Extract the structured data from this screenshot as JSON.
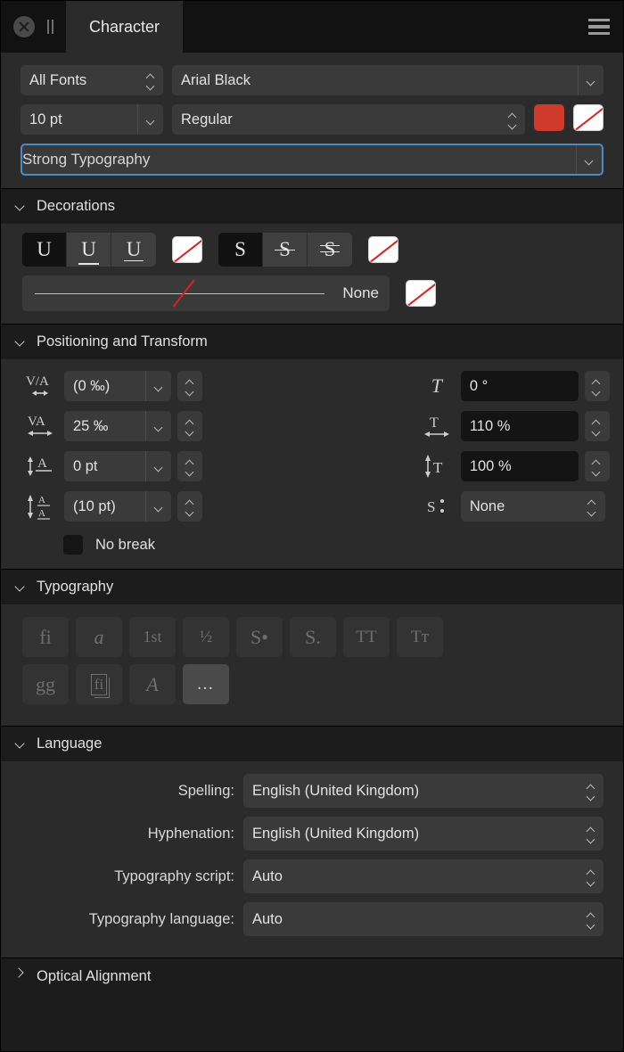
{
  "window": {
    "tab_label": "Character",
    "close_icon": "close-circle-icon",
    "grip_icon": "pause-grip-icon",
    "menu_icon": "hamburger-menu-icon"
  },
  "font_controls": {
    "font_class": "All Fonts",
    "font_family": "Arial Black",
    "font_size": "10 pt",
    "font_style": "Regular",
    "fill_color": "#cf3a2a",
    "stroke_color": "none",
    "text_style": "Strong Typography"
  },
  "sections": {
    "decorations": {
      "title": "Decorations",
      "expanded": true
    },
    "positioning": {
      "title": "Positioning and Transform",
      "expanded": true
    },
    "typography": {
      "title": "Typography",
      "expanded": true
    },
    "language": {
      "title": "Language",
      "expanded": true
    },
    "optical_alignment": {
      "title": "Optical Alignment",
      "expanded": false
    }
  },
  "decorations": {
    "underline_buttons": [
      {
        "label": "U",
        "name": "underline-none-button",
        "active": true
      },
      {
        "label": "U",
        "name": "underline-single-button",
        "active": false
      },
      {
        "label": "U",
        "name": "underline-double-button",
        "active": false
      }
    ],
    "underline_color": "none",
    "strikethrough_buttons": [
      {
        "label": "S",
        "name": "strikethrough-none-button",
        "active": true
      },
      {
        "label": "S",
        "name": "strikethrough-single-button",
        "active": false
      },
      {
        "label": "S",
        "name": "strikethrough-double-button",
        "active": false
      }
    ],
    "strikethrough_color": "none",
    "line_style_label": "None",
    "line_style_color": "none"
  },
  "positioning": {
    "left_fields": [
      {
        "icon": "kerning-icon",
        "value": "(0 ‰)",
        "name": "kerning-field"
      },
      {
        "icon": "tracking-icon",
        "value": "25 ‰",
        "name": "tracking-field"
      },
      {
        "icon": "baseline-shift-icon",
        "value": "0 pt",
        "name": "baseline-shift-field"
      },
      {
        "icon": "leading-override-icon",
        "value": "(10 pt)",
        "name": "leading-override-field"
      }
    ],
    "right_fields": [
      {
        "icon": "skew-icon",
        "value": "0 °",
        "name": "skew-field"
      },
      {
        "icon": "horizontal-scale-icon",
        "value": "110 %",
        "name": "horizontal-scale-field"
      },
      {
        "icon": "vertical-scale-icon",
        "value": "100 %",
        "name": "vertical-scale-field"
      },
      {
        "icon": "position-icon",
        "value": "None",
        "name": "position-field"
      }
    ],
    "no_break_label": "No break",
    "no_break_checked": false
  },
  "typography": {
    "row1": [
      {
        "glyph": "fi",
        "name": "standard-ligatures-button",
        "enabled": false
      },
      {
        "glyph": "a",
        "name": "discretionary-ligatures-button",
        "enabled": false
      },
      {
        "glyph": "1st",
        "name": "ordinals-button",
        "enabled": false
      },
      {
        "glyph": "½",
        "name": "fractions-button",
        "enabled": false
      },
      {
        "glyph": "S•",
        "name": "superscript-button",
        "enabled": false
      },
      {
        "glyph": "S.",
        "name": "subscript-button",
        "enabled": false
      },
      {
        "glyph": "TT",
        "name": "all-caps-button",
        "enabled": false
      },
      {
        "glyph": "Tт",
        "name": "small-caps-button",
        "enabled": false
      }
    ],
    "row2": [
      {
        "glyph": "gg",
        "name": "alternate-glyphs-button",
        "enabled": false
      },
      {
        "glyph": "fi",
        "name": "contextual-alternates-button",
        "enabled": false
      },
      {
        "glyph": "A",
        "name": "swash-button",
        "enabled": false
      },
      {
        "glyph": "…",
        "name": "more-typography-button",
        "enabled": true
      }
    ]
  },
  "language": {
    "rows": [
      {
        "label": "Spelling:",
        "value": "English (United Kingdom)",
        "name": "spelling-select"
      },
      {
        "label": "Hyphenation:",
        "value": "English (United Kingdom)",
        "name": "hyphenation-select"
      },
      {
        "label": "Typography script:",
        "value": "Auto",
        "name": "typography-script-select"
      },
      {
        "label": "Typography language:",
        "value": "Auto",
        "name": "typography-language-select"
      }
    ]
  }
}
